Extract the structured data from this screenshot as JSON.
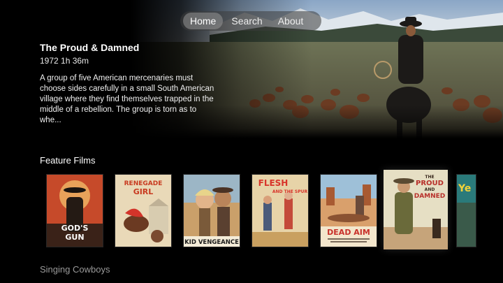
{
  "nav": {
    "items": [
      {
        "label": "Home",
        "active": true
      },
      {
        "label": "Search",
        "active": false
      },
      {
        "label": "About",
        "active": false
      }
    ]
  },
  "featured": {
    "title": "The Proud & Damned",
    "meta": "1972 1h 36m",
    "description": "A group of five American mercenaries must choose sides carefully in a small South American village where they find themselves trapped in the middle of a rebellion. The group is torn as to whe..."
  },
  "sections": [
    {
      "title": "Feature Films"
    },
    {
      "title": "Singing Cowboys"
    }
  ],
  "posters": [
    {
      "title_line1": "GOD'S",
      "title_line2": "GUN",
      "color": "#c64a2a"
    },
    {
      "title_line1": "RENEGADE",
      "title_line2": "GIRL",
      "color": "#e9d9b8"
    },
    {
      "title_line1": "KID VENGEANCE",
      "title_line2": "",
      "color": "#caa06a"
    },
    {
      "title_line1": "FLESH",
      "title_line2": "AND THE SPUR",
      "color": "#e7d3a8"
    },
    {
      "title_line1": "DEAD AIM",
      "title_line2": "",
      "color": "#d9a06c"
    },
    {
      "title_line1": "PROUD",
      "title_line2": "DAMNED",
      "color": "#e6dfc4"
    },
    {
      "title_line1": "Ye",
      "title_line2": "",
      "color": "#2a7a7a"
    }
  ]
}
